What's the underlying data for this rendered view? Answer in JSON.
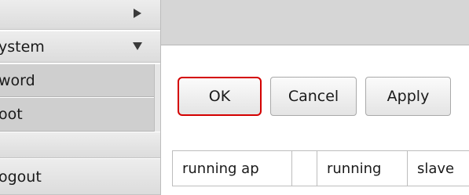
{
  "sidebar": {
    "items": [
      {
        "label": "",
        "icon": "triangle-right-icon"
      },
      {
        "label": "ystem",
        "icon": "triangle-down-icon"
      },
      {
        "label": "word"
      },
      {
        "label": "oot"
      },
      {
        "label": ""
      },
      {
        "label": "ogout"
      }
    ]
  },
  "toolbar": {
    "ok_label": "OK",
    "cancel_label": "Cancel",
    "apply_label": "Apply"
  },
  "table": {
    "columns": [
      "running ap",
      "",
      "running",
      "slave"
    ]
  },
  "colors": {
    "highlight_border": "#d40000",
    "topbar": "#d6d6d6",
    "sidebar_selected": "#cfcfcf"
  }
}
